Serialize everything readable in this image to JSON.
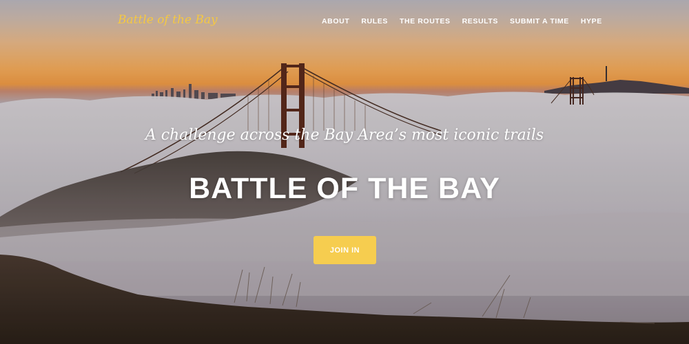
{
  "brand": {
    "name": "Battle of the Bay",
    "color": "#f5c842"
  },
  "nav": {
    "items": [
      {
        "label": "ABOUT"
      },
      {
        "label": "RULES"
      },
      {
        "label": "THE ROUTES"
      },
      {
        "label": "RESULTS"
      },
      {
        "label": "SUBMIT A TIME"
      },
      {
        "label": "HYPE"
      }
    ]
  },
  "hero": {
    "tagline": "A challenge across the Bay Area’s most iconic trails",
    "headline": "BATTLE OF THE BAY",
    "cta_label": "JOIN IN",
    "cta_color": "#f6cd4f",
    "background_image": "golden-gate-bridge-above-fog-at-sunset"
  }
}
